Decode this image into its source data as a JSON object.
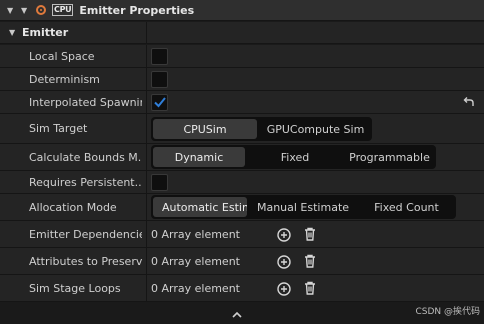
{
  "header": {
    "title": "Emitter Properties",
    "badge": "CPU"
  },
  "section": {
    "label": "Emitter"
  },
  "rows": [
    {
      "label": "Local Space",
      "checked": false
    },
    {
      "label": "Determinism",
      "checked": false
    },
    {
      "label": "Interpolated Spawning",
      "checked": true
    },
    {
      "label": "Sim Target",
      "options": [
        "CPUSim",
        "GPUCompute Sim"
      ],
      "selected": "CPUSim"
    },
    {
      "label": "Calculate Bounds M...",
      "options": [
        "Dynamic",
        "Fixed",
        "Programmable"
      ],
      "selected": "Dynamic"
    },
    {
      "label": "Requires Persistent...",
      "checked": false
    },
    {
      "label": "Allocation Mode",
      "options": [
        "Automatic Estima",
        "Manual Estimate",
        "Fixed Count"
      ],
      "selected": "Automatic Estima"
    },
    {
      "label": "Emitter Dependencies",
      "value": "0 Array element"
    },
    {
      "label": "Attributes to Preserve",
      "value": "0 Array element"
    },
    {
      "label": "Sim Stage Loops",
      "value": "0 Array element"
    }
  ],
  "watermark": "CSDN @挨代码",
  "colors": {
    "check": "#2f7ed8",
    "accent": "#e07a3c"
  },
  "icons": [
    "chevron-down-icon",
    "visibility-icon",
    "cpu-icon",
    "checkmark-icon",
    "reset-arrow-icon",
    "add-circle-icon",
    "trash-icon",
    "chevron-up-icon"
  ]
}
